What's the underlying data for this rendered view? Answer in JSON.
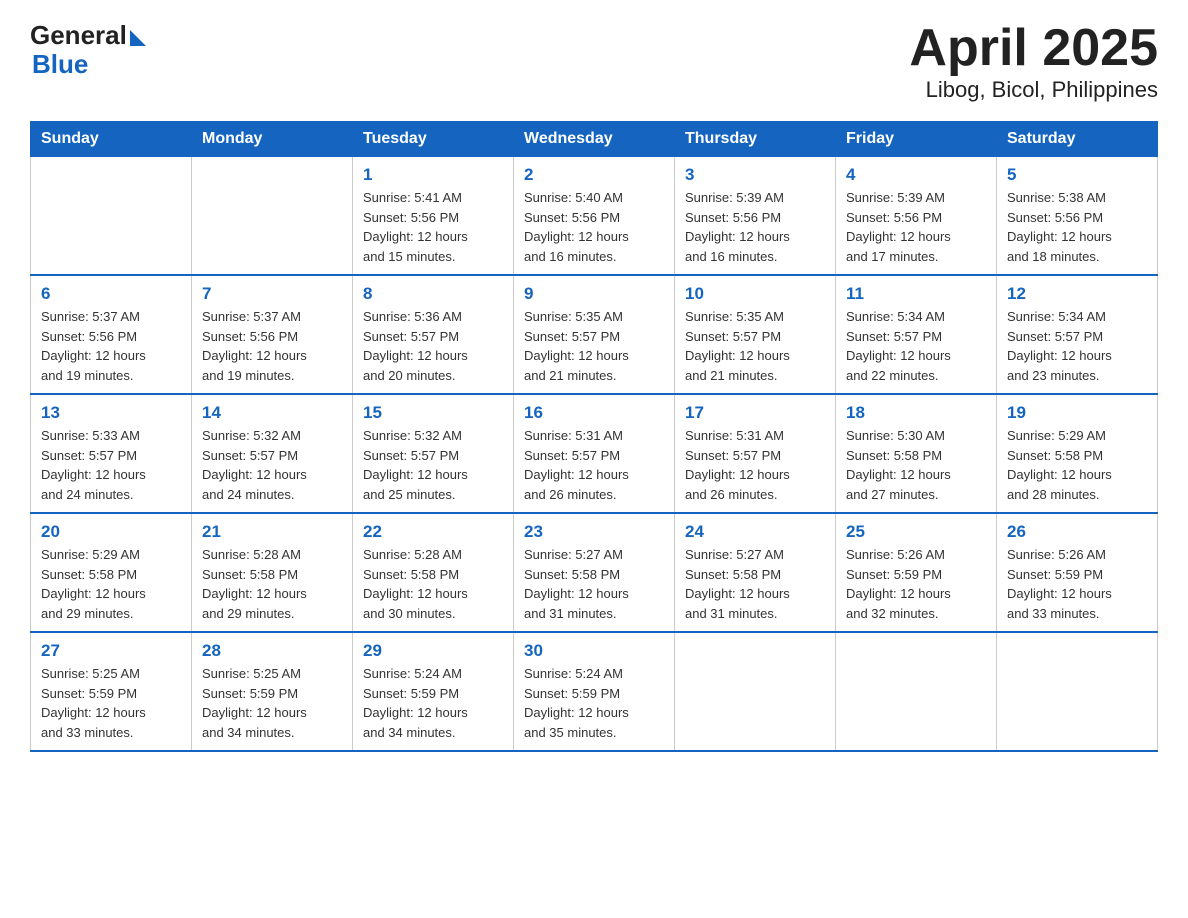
{
  "header": {
    "logo": {
      "general": "General",
      "blue": "Blue"
    },
    "title": "April 2025",
    "subtitle": "Libog, Bicol, Philippines"
  },
  "calendar": {
    "weekdays": [
      "Sunday",
      "Monday",
      "Tuesday",
      "Wednesday",
      "Thursday",
      "Friday",
      "Saturday"
    ],
    "weeks": [
      [
        {
          "day": "",
          "info": ""
        },
        {
          "day": "",
          "info": ""
        },
        {
          "day": "1",
          "info": "Sunrise: 5:41 AM\nSunset: 5:56 PM\nDaylight: 12 hours\nand 15 minutes."
        },
        {
          "day": "2",
          "info": "Sunrise: 5:40 AM\nSunset: 5:56 PM\nDaylight: 12 hours\nand 16 minutes."
        },
        {
          "day": "3",
          "info": "Sunrise: 5:39 AM\nSunset: 5:56 PM\nDaylight: 12 hours\nand 16 minutes."
        },
        {
          "day": "4",
          "info": "Sunrise: 5:39 AM\nSunset: 5:56 PM\nDaylight: 12 hours\nand 17 minutes."
        },
        {
          "day": "5",
          "info": "Sunrise: 5:38 AM\nSunset: 5:56 PM\nDaylight: 12 hours\nand 18 minutes."
        }
      ],
      [
        {
          "day": "6",
          "info": "Sunrise: 5:37 AM\nSunset: 5:56 PM\nDaylight: 12 hours\nand 19 minutes."
        },
        {
          "day": "7",
          "info": "Sunrise: 5:37 AM\nSunset: 5:56 PM\nDaylight: 12 hours\nand 19 minutes."
        },
        {
          "day": "8",
          "info": "Sunrise: 5:36 AM\nSunset: 5:57 PM\nDaylight: 12 hours\nand 20 minutes."
        },
        {
          "day": "9",
          "info": "Sunrise: 5:35 AM\nSunset: 5:57 PM\nDaylight: 12 hours\nand 21 minutes."
        },
        {
          "day": "10",
          "info": "Sunrise: 5:35 AM\nSunset: 5:57 PM\nDaylight: 12 hours\nand 21 minutes."
        },
        {
          "day": "11",
          "info": "Sunrise: 5:34 AM\nSunset: 5:57 PM\nDaylight: 12 hours\nand 22 minutes."
        },
        {
          "day": "12",
          "info": "Sunrise: 5:34 AM\nSunset: 5:57 PM\nDaylight: 12 hours\nand 23 minutes."
        }
      ],
      [
        {
          "day": "13",
          "info": "Sunrise: 5:33 AM\nSunset: 5:57 PM\nDaylight: 12 hours\nand 24 minutes."
        },
        {
          "day": "14",
          "info": "Sunrise: 5:32 AM\nSunset: 5:57 PM\nDaylight: 12 hours\nand 24 minutes."
        },
        {
          "day": "15",
          "info": "Sunrise: 5:32 AM\nSunset: 5:57 PM\nDaylight: 12 hours\nand 25 minutes."
        },
        {
          "day": "16",
          "info": "Sunrise: 5:31 AM\nSunset: 5:57 PM\nDaylight: 12 hours\nand 26 minutes."
        },
        {
          "day": "17",
          "info": "Sunrise: 5:31 AM\nSunset: 5:57 PM\nDaylight: 12 hours\nand 26 minutes."
        },
        {
          "day": "18",
          "info": "Sunrise: 5:30 AM\nSunset: 5:58 PM\nDaylight: 12 hours\nand 27 minutes."
        },
        {
          "day": "19",
          "info": "Sunrise: 5:29 AM\nSunset: 5:58 PM\nDaylight: 12 hours\nand 28 minutes."
        }
      ],
      [
        {
          "day": "20",
          "info": "Sunrise: 5:29 AM\nSunset: 5:58 PM\nDaylight: 12 hours\nand 29 minutes."
        },
        {
          "day": "21",
          "info": "Sunrise: 5:28 AM\nSunset: 5:58 PM\nDaylight: 12 hours\nand 29 minutes."
        },
        {
          "day": "22",
          "info": "Sunrise: 5:28 AM\nSunset: 5:58 PM\nDaylight: 12 hours\nand 30 minutes."
        },
        {
          "day": "23",
          "info": "Sunrise: 5:27 AM\nSunset: 5:58 PM\nDaylight: 12 hours\nand 31 minutes."
        },
        {
          "day": "24",
          "info": "Sunrise: 5:27 AM\nSunset: 5:58 PM\nDaylight: 12 hours\nand 31 minutes."
        },
        {
          "day": "25",
          "info": "Sunrise: 5:26 AM\nSunset: 5:59 PM\nDaylight: 12 hours\nand 32 minutes."
        },
        {
          "day": "26",
          "info": "Sunrise: 5:26 AM\nSunset: 5:59 PM\nDaylight: 12 hours\nand 33 minutes."
        }
      ],
      [
        {
          "day": "27",
          "info": "Sunrise: 5:25 AM\nSunset: 5:59 PM\nDaylight: 12 hours\nand 33 minutes."
        },
        {
          "day": "28",
          "info": "Sunrise: 5:25 AM\nSunset: 5:59 PM\nDaylight: 12 hours\nand 34 minutes."
        },
        {
          "day": "29",
          "info": "Sunrise: 5:24 AM\nSunset: 5:59 PM\nDaylight: 12 hours\nand 34 minutes."
        },
        {
          "day": "30",
          "info": "Sunrise: 5:24 AM\nSunset: 5:59 PM\nDaylight: 12 hours\nand 35 minutes."
        },
        {
          "day": "",
          "info": ""
        },
        {
          "day": "",
          "info": ""
        },
        {
          "day": "",
          "info": ""
        }
      ]
    ]
  }
}
